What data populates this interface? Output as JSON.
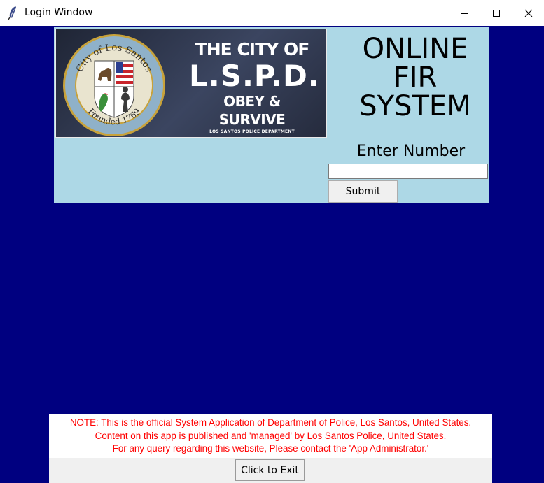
{
  "window": {
    "title": "Login Window",
    "app_icon": "feather-icon",
    "controls": {
      "minimize": "minimize-icon",
      "maximize": "maximize-icon",
      "close": "close-icon"
    }
  },
  "colors": {
    "background": "#000080",
    "header_panel": "#add8e6",
    "note_text": "#ff0000"
  },
  "banner": {
    "seal_ring_text_top": "City of Los Santos",
    "seal_ring_text_bottom": "Founded 1769",
    "line1": "THE CITY OF",
    "line2": "L.S.P.D.",
    "line3": "OBEY & SURVIVE",
    "line4": "LOS SANTOS POLICE DEPARTMENT"
  },
  "header": {
    "title_line1": "ONLINE",
    "title_line2": "FIR",
    "title_line3": "SYSTEM",
    "enter_label": "Enter Number",
    "input_value": "",
    "submit_label": "Submit"
  },
  "footer": {
    "note_line1": "NOTE: This is the official System Application of Department of Police, Los Santos, United States.",
    "note_line2": "Content on this app is published and 'managed' by Los Santos Police, United States.",
    "note_line3": "For any query regarding this website, Please contact the 'App Administrator.'",
    "exit_label": "Click to Exit"
  }
}
